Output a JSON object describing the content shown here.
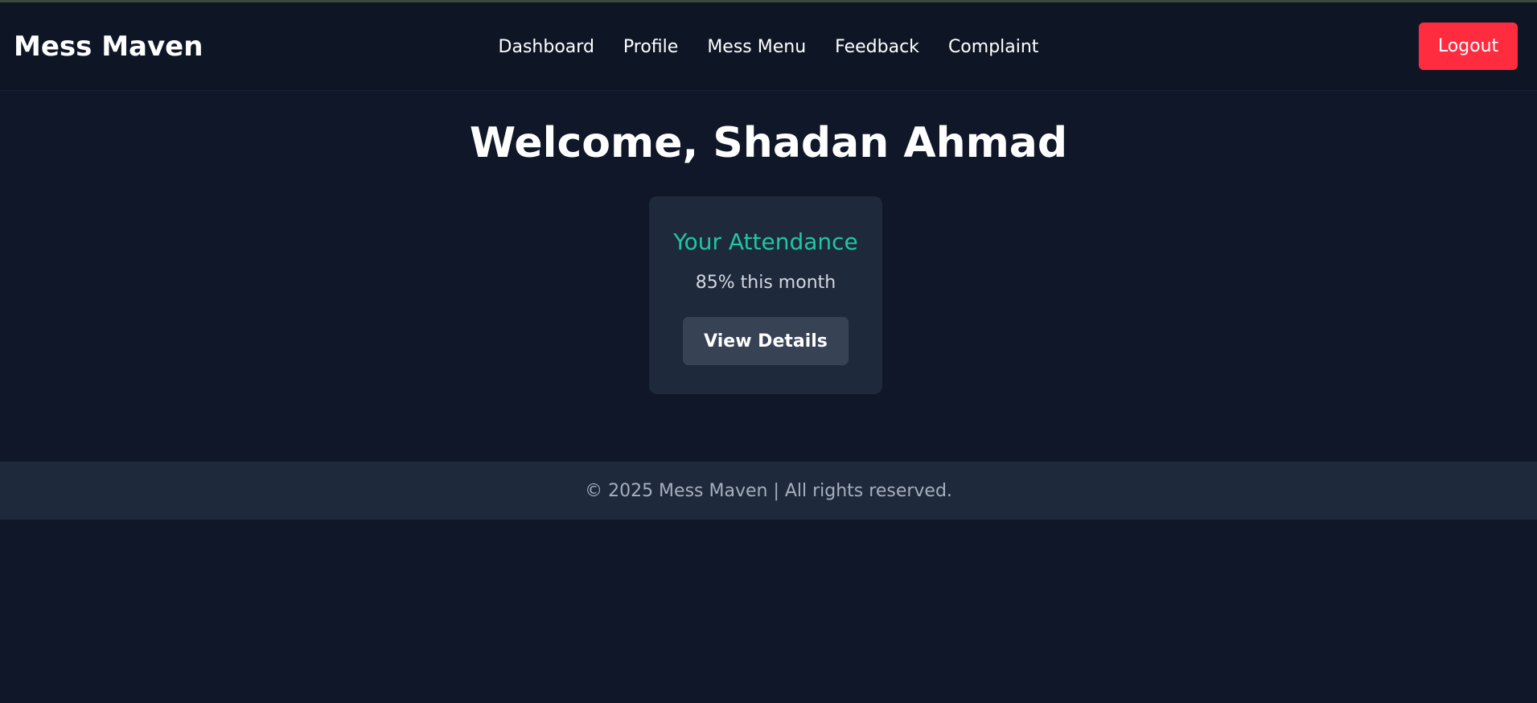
{
  "header": {
    "brand": "Mess Maven",
    "nav": [
      {
        "label": "Dashboard"
      },
      {
        "label": "Profile"
      },
      {
        "label": "Mess Menu"
      },
      {
        "label": "Feedback"
      },
      {
        "label": "Complaint"
      }
    ],
    "logout_label": "Logout"
  },
  "main": {
    "welcome": "Welcome, Shadan Ahmad",
    "attendance_card": {
      "title": "Your Attendance",
      "summary": "85% this month",
      "button_label": "View Details"
    }
  },
  "footer": {
    "text": "© 2025 Mess Maven | All rights reserved."
  },
  "colors": {
    "background": "#0f1728",
    "card": "#1e293b",
    "accent": "#1fc7a4",
    "logout": "#ff2b3f",
    "button": "#374255"
  }
}
